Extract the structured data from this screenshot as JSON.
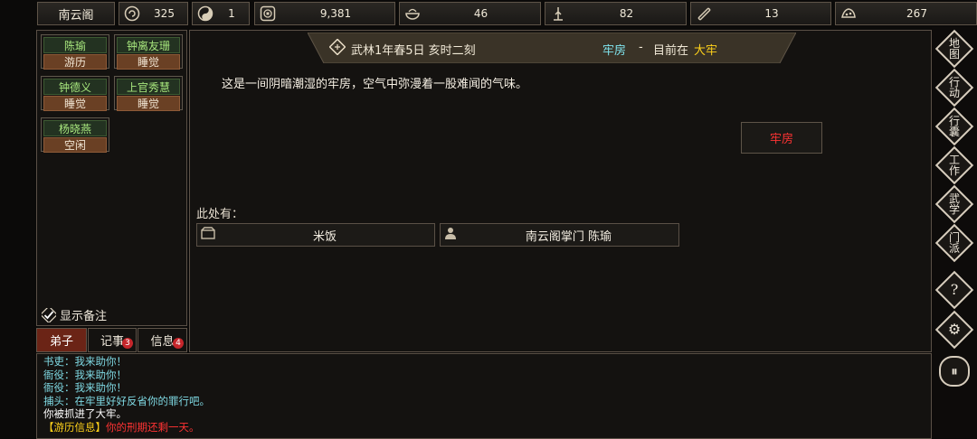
{
  "top": {
    "sect_name": "南云阁",
    "resources": [
      {
        "icon": "spiral-icon",
        "value": "325"
      },
      {
        "icon": "yin-yang-icon",
        "value": "1"
      },
      {
        "icon": "coin-icon",
        "value": "9,381"
      },
      {
        "icon": "food-bowl-icon",
        "value": "46"
      },
      {
        "icon": "wood-icon",
        "value": "82"
      },
      {
        "icon": "scroll-icon",
        "value": "13"
      },
      {
        "icon": "stone-icon",
        "value": "267"
      }
    ]
  },
  "disciples": [
    {
      "name": "陈瑜",
      "status": "游历"
    },
    {
      "name": "钟离友珊",
      "status": "睡觉"
    },
    {
      "name": "钟德义",
      "status": "睡觉"
    },
    {
      "name": "上官秀慧",
      "status": "睡觉"
    },
    {
      "name": "杨晓燕",
      "status": "空闲"
    }
  ],
  "show_notes_label": "显示备注",
  "tabs": [
    {
      "label": "弟子",
      "badge": ""
    },
    {
      "label": "记事",
      "badge": "3"
    },
    {
      "label": "信息",
      "badge": "4"
    }
  ],
  "header": {
    "date": "武林1年春5日 亥时二刻",
    "location": "牢房",
    "separator": "-",
    "current_prefix": "目前在",
    "current_place": "大牢"
  },
  "description": "这是一间阴暗潮湿的牢房，空气中弥漫着一股难闻的气味。",
  "room_button": "牢房",
  "here_label": "此处有：",
  "here_items": [
    {
      "icon": "chest-icon",
      "label": "米饭"
    },
    {
      "icon": "person-icon",
      "label": "南云阁掌门 陈瑜"
    }
  ],
  "side_menu": [
    {
      "chars": [
        "地",
        "图"
      ]
    },
    {
      "chars": [
        "行",
        "动"
      ]
    },
    {
      "chars": [
        "行",
        "囊"
      ]
    },
    {
      "chars": [
        "工",
        "作"
      ]
    },
    {
      "chars": [
        "武",
        "学"
      ]
    },
    {
      "chars": [
        "门",
        "派"
      ]
    },
    {
      "chars": [
        "?"
      ]
    },
    {
      "chars": [
        "⚙"
      ]
    },
    {
      "chars": [
        "⏸"
      ]
    }
  ],
  "log": [
    {
      "text": "书吏：我来助你！",
      "color": "#7fd9e3"
    },
    {
      "text": "衙役：我来助你！",
      "color": "#7fd9e3"
    },
    {
      "text": "衙役：我来助你！",
      "color": "#7fd9e3"
    },
    {
      "text": "捕头：在牢里好好反省你的罪行吧。",
      "color": "#7fd9e3"
    },
    {
      "text": "你被抓进了大牢。",
      "color": "#ffffff"
    },
    {
      "prefix": "【游历信息】",
      "text": "你的刑期还剩一天。",
      "color": "#ff3333",
      "prefix_color": "#ffd21a"
    }
  ],
  "colors": {
    "accent_cyan": "#7fe4ee",
    "accent_yellow": "#ffd21a",
    "room_red": "#ff3333"
  }
}
